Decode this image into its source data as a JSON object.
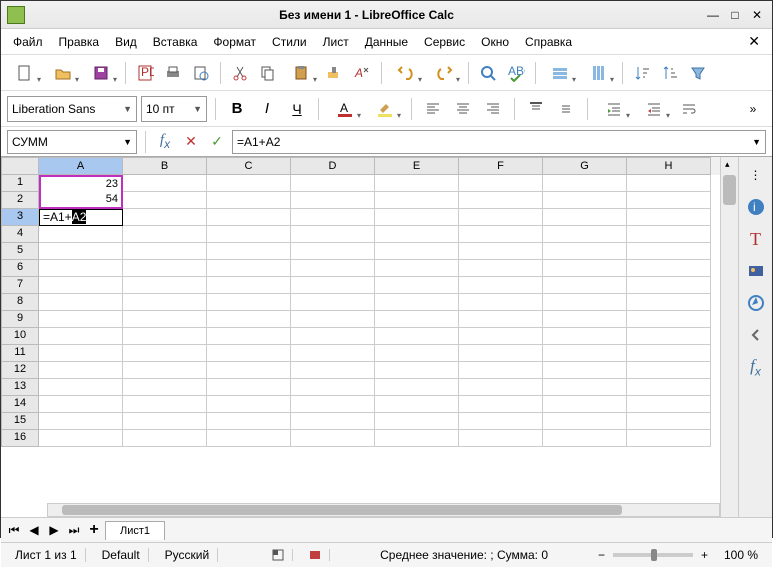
{
  "window": {
    "title": "Без имени 1 - LibreOffice Calc"
  },
  "menu": [
    "Файл",
    "Правка",
    "Вид",
    "Вставка",
    "Формат",
    "Стили",
    "Лист",
    "Данные",
    "Сервис",
    "Окно",
    "Справка"
  ],
  "font": {
    "name": "Liberation Sans",
    "size": "10 пт"
  },
  "namebox": "СУММ",
  "formula": "=A1+A2",
  "cell_edit_prefix": "=A1+",
  "cell_edit_sel": "A2",
  "columns": [
    "A",
    "B",
    "C",
    "D",
    "E",
    "F",
    "G",
    "H"
  ],
  "rows": 16,
  "cells": {
    "A1": "23",
    "A2": "54"
  },
  "active_col": 0,
  "active_row": 3,
  "sheet_tab": "Лист1",
  "status": {
    "sheet": "Лист 1 из 1",
    "style": "Default",
    "lang": "Русский",
    "stats": "Среднее значение: ; Сумма: 0",
    "zoom": "100 %"
  }
}
